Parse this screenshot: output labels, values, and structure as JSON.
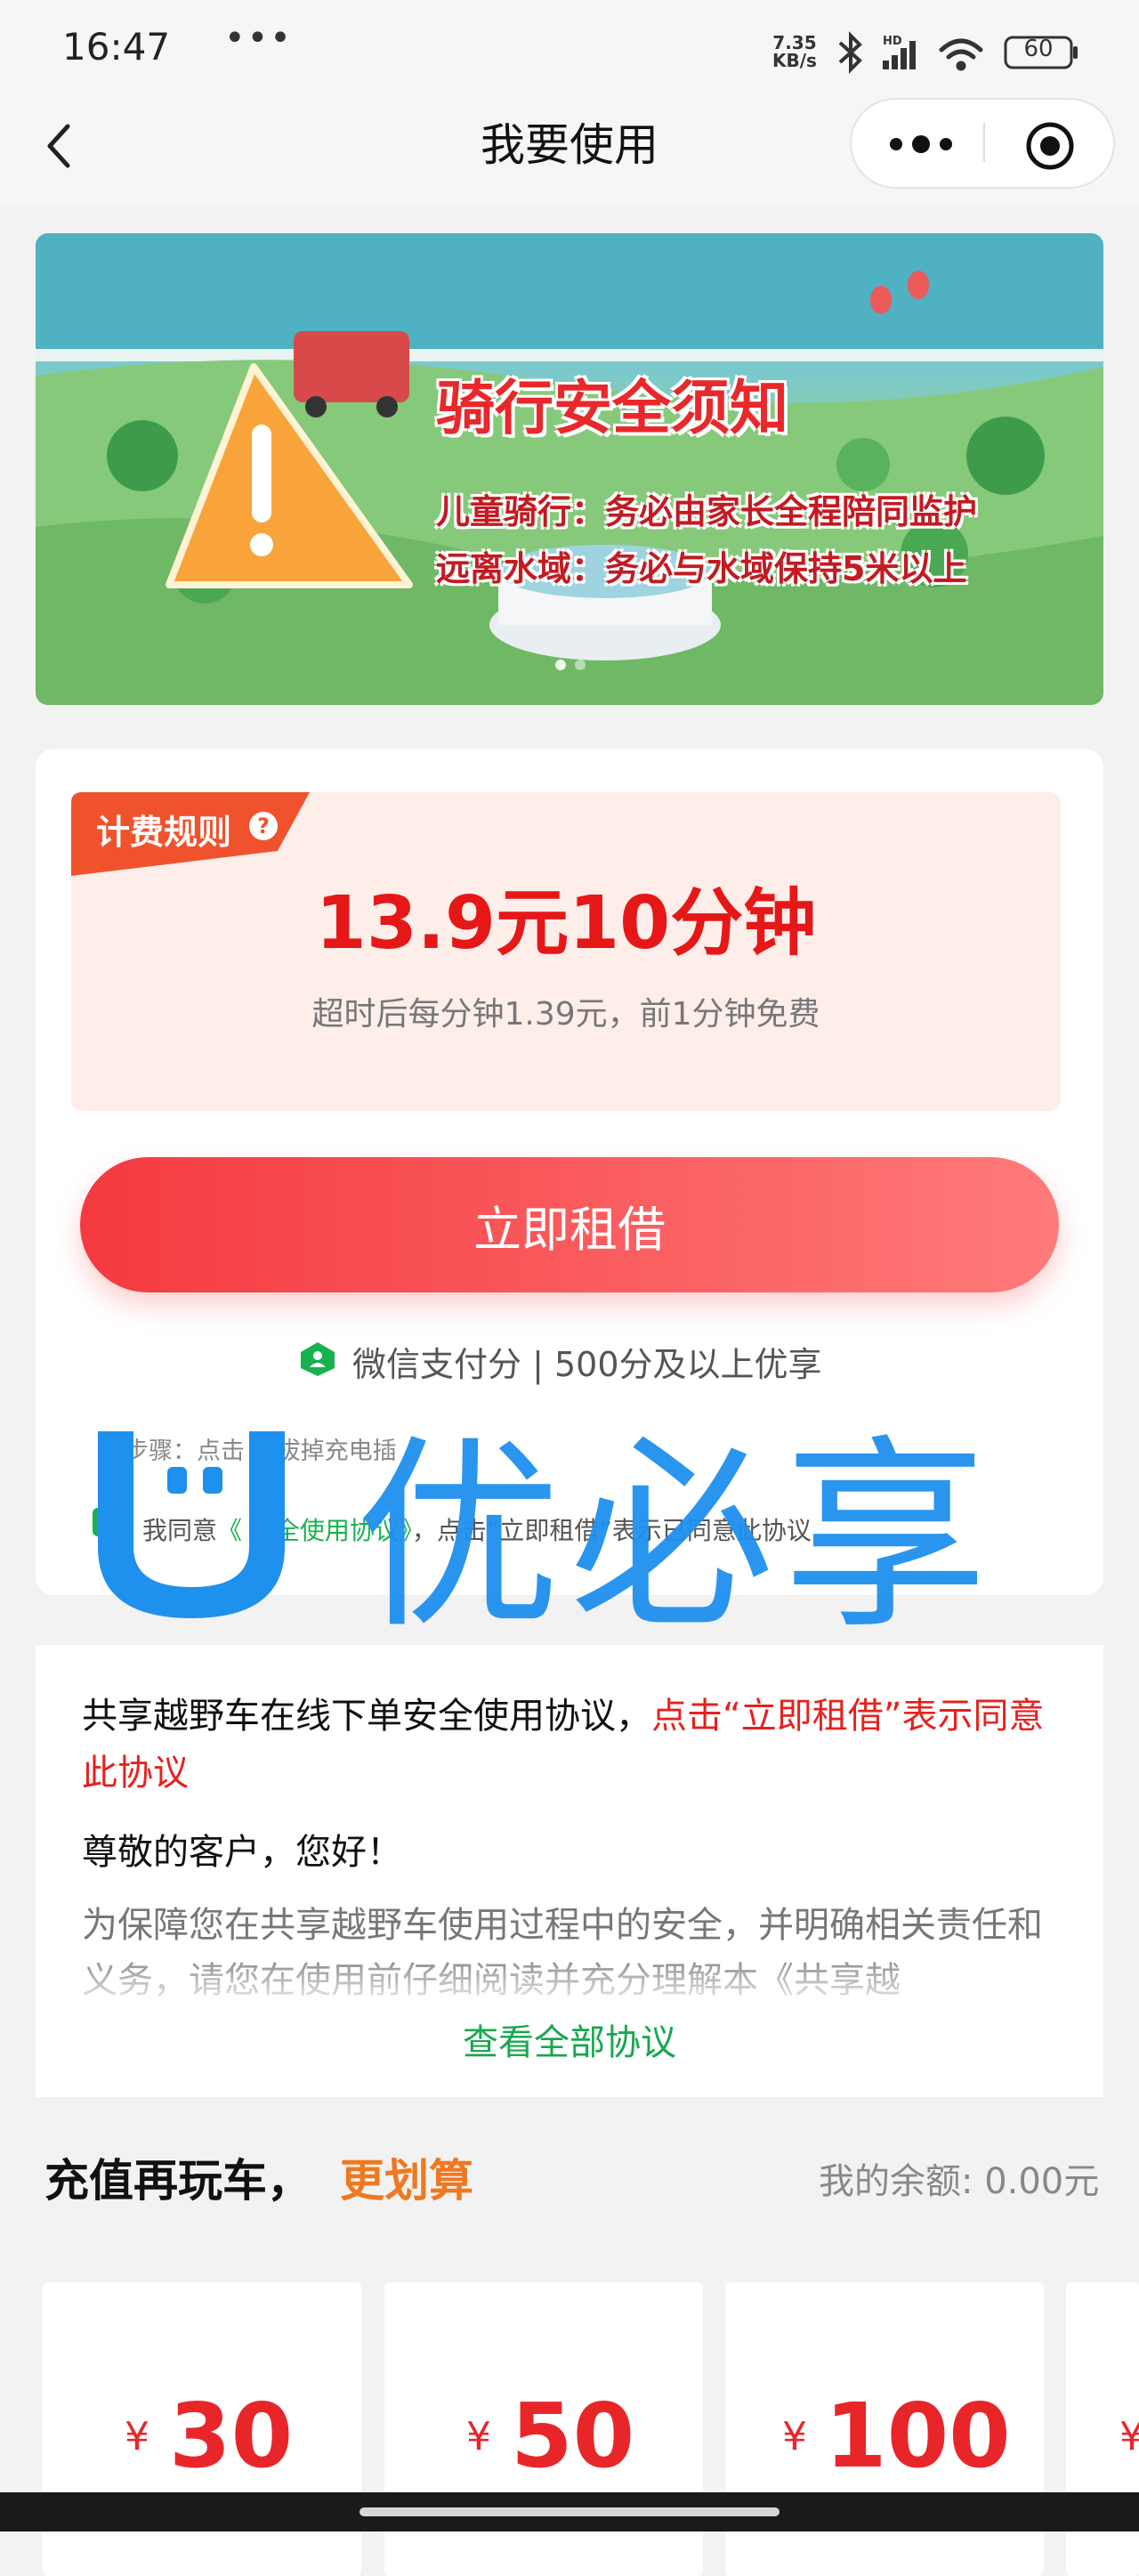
{
  "status_bar": {
    "time": "16:47",
    "dots": "•••",
    "net_speed_value": "7.35",
    "net_speed_unit": "KB/s",
    "battery": "60"
  },
  "nav": {
    "title": "我要使用",
    "more_icon": "more-dots-icon",
    "close_icon": "target-circle-icon"
  },
  "banner": {
    "title": "骑行安全须知",
    "line1": "儿童骑行：务必由家长全程陪同监护",
    "line2": "远离水域：务必与水域保持5米以上"
  },
  "pricing": {
    "rule_tag": "计费规则",
    "rule_help": "?",
    "price": "13.9元10分钟",
    "sub": "超时后每分钟1.39元，前1分钟免费"
  },
  "rent_button": "立即租借",
  "wechat_pay": "微信支付分 | 500分及以上优享",
  "steps_text": "步骤：点击        ，拔掉充电插",
  "agree": {
    "prefix": "我同意",
    "link": "《   安全使用协议》",
    "suffix": "，点击“立即租借”表示已同意此协议"
  },
  "watermark": {
    "text": "优必享"
  },
  "agreement": {
    "p1_black": "共享越野车在线下单安全使用协议，",
    "p1_red": "点击“立即租借”表示同意此协议",
    "greeting": "尊敬的客户，您好！",
    "body": "为保障您在共享越野车使用过程中的安全，并明确相关责任和义务，请您在使用前仔细阅读并充分理解本《共享越",
    "view_all": "查看全部协议"
  },
  "recharge": {
    "title": "充值再玩车，",
    "accent": "更划算",
    "balance": "我的余额: 0.00元",
    "currency": "¥",
    "tiles": [
      "30",
      "50",
      "100"
    ]
  },
  "colors": {
    "accent_red": "#e61717",
    "button_red": "#f43a3f",
    "green": "#17b24f",
    "orange": "#f07820",
    "watermark_blue": "#1e90ee"
  }
}
